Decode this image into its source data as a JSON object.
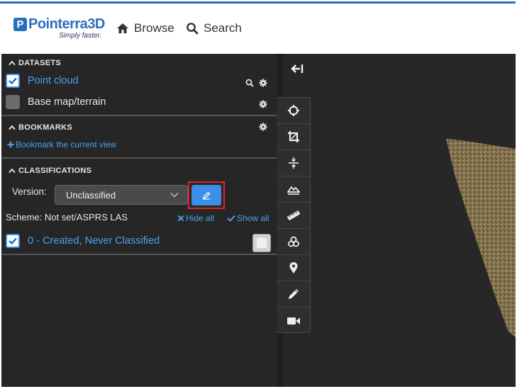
{
  "header": {
    "logo_name": "Pointerra",
    "logo_3d": "3D",
    "logo_tagline": "Simply faster.",
    "nav": [
      {
        "label": "Browse",
        "icon": "home-icon"
      },
      {
        "label": "Search",
        "icon": "search-icon"
      }
    ]
  },
  "datasets": {
    "title": "DATASETS",
    "items": [
      {
        "label": "Point cloud",
        "checked": true
      },
      {
        "label": "Base map/terrain",
        "checked": false
      }
    ]
  },
  "bookmarks": {
    "title": "BOOKMARKS",
    "add_link": "Bookmark the current view"
  },
  "classifications": {
    "title": "CLASSIFICATIONS",
    "version_label": "Version:",
    "version_value": "Unclassified",
    "scheme_text": "Scheme: Not set/ASPRS LAS",
    "hide_all": "Hide all",
    "show_all": "Show all",
    "items": [
      {
        "label": "0 - Created, Never Classified",
        "checked": true
      }
    ]
  },
  "toolbar": {
    "tools": [
      "target-icon",
      "crop-icon",
      "section-icon",
      "terrain-profile-icon",
      "ruler-icon",
      "volume-icon",
      "map-marker-icon",
      "pencil-icon",
      "video-camera-icon"
    ]
  },
  "colors": {
    "brand": "#2a6fbe",
    "accent": "#3b8fe8",
    "link": "#4aa0f0",
    "panel_bg": "#262626",
    "highlight": "#e0242b"
  }
}
